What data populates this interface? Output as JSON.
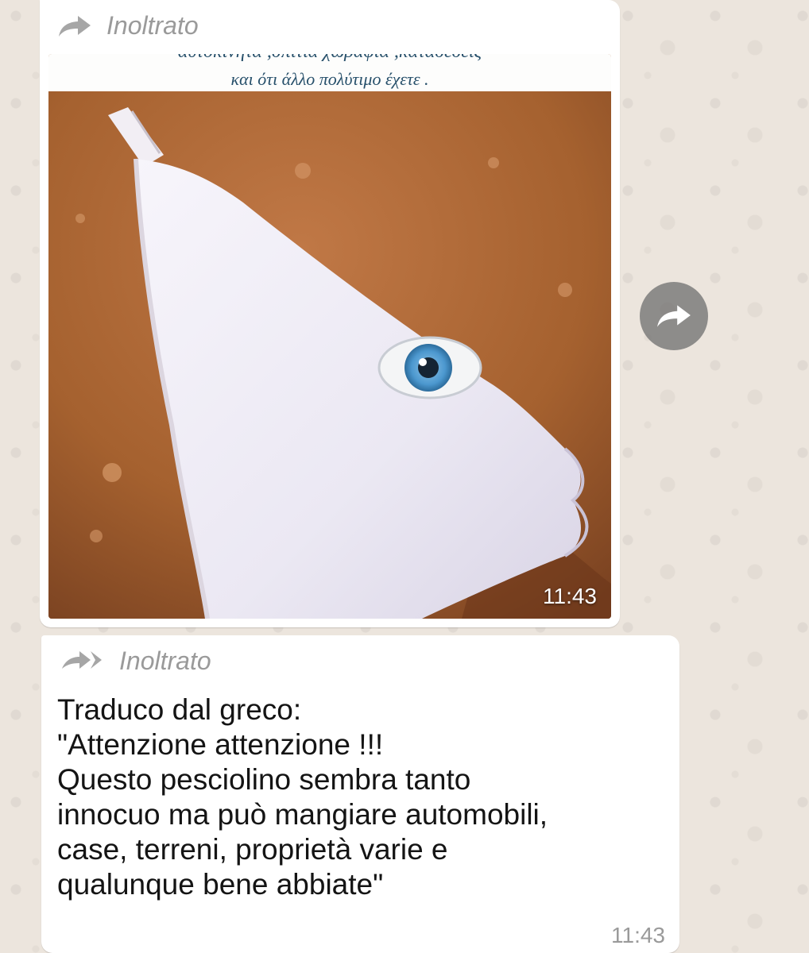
{
  "messages": [
    {
      "forwarded_label": "Inoltrato",
      "forward_icon": "forward-arrow-icon",
      "media": {
        "caption_line_1": "αυτοκινητα ,σπιτια χωραφια ,κατασεσεις",
        "caption_line_2": "και ότι άλλο πολύτιμο έχετε .",
        "description_icon": "fish-eye-bikini-photo"
      },
      "time": "11:43"
    },
    {
      "forwarded_label": "Inoltrato",
      "forward_icon": "forwarded-many-times-icon",
      "text": "Traduco dal greco:\n\"Attenzione attenzione !!!\nQuesto pesciolino sembra tanto\ninnocuo ma può mangiare automobili,\ncase, terreni, proprietà varie e\nqualunque bene abbiate\"",
      "time": "11:43"
    }
  ],
  "share_button_icon": "share-forward-icon",
  "colors": {
    "background": "#ece5dd",
    "bubble": "#ffffff",
    "meta_text": "#9a9a9a",
    "share_button": "#6e6e6e"
  }
}
